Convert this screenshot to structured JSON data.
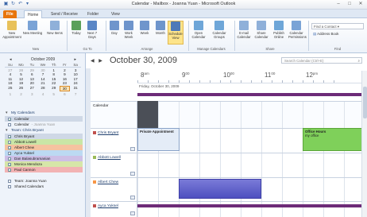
{
  "window": {
    "title": "Calendar - Mailbox - Joanna Yuan - Microsoft Outlook",
    "controls": [
      "–",
      "□",
      "✕"
    ]
  },
  "tabs": [
    "File",
    "Home",
    "Send / Receive",
    "Folder",
    "View"
  ],
  "ribbon": {
    "buttons": [
      {
        "label": "New Appointment",
        "icon": "new-appointment-icon",
        "color": "#e8c15a"
      },
      {
        "label": "New Meeting",
        "icon": "new-meeting-icon",
        "color": "#7aa3d6"
      },
      {
        "label": "New Items",
        "icon": "new-items-icon",
        "color": "#8fb0d9"
      },
      {
        "label": "Today",
        "icon": "today-icon",
        "color": "#5aa05a"
      },
      {
        "label": "Next 7 Days",
        "icon": "next-7-days-icon",
        "color": "#5a86c6"
      },
      {
        "label": "Day",
        "icon": "day-view-icon",
        "color": "#6f95cc"
      },
      {
        "label": "Work Week",
        "icon": "work-week-icon",
        "color": "#6f95cc"
      },
      {
        "label": "Week",
        "icon": "week-view-icon",
        "color": "#6f95cc"
      },
      {
        "label": "Month",
        "icon": "month-view-icon",
        "color": "#6f95cc"
      },
      {
        "label": "Schedule View",
        "icon": "schedule-view-icon",
        "color": "#4f79b8"
      },
      {
        "label": "Open Calendar",
        "icon": "open-calendar-icon",
        "color": "#6ea6d8"
      },
      {
        "label": "Calendar Groups",
        "icon": "calendar-groups-icon",
        "color": "#6ea6d8"
      },
      {
        "label": "E-mail Calendar",
        "icon": "email-calendar-icon",
        "color": "#8fb0d9"
      },
      {
        "label": "Share Calendar",
        "icon": "share-calendar-icon",
        "color": "#8fb0d9"
      },
      {
        "label": "Publish Online",
        "icon": "publish-online-icon",
        "color": "#6ea6d8"
      },
      {
        "label": "Calendar Permissions",
        "icon": "calendar-permissions-icon",
        "color": "#7aa3d6"
      }
    ],
    "groups": [
      "New",
      "Go To",
      "Arrange",
      "Manage Calendars",
      "Share",
      "Find"
    ],
    "find_placeholder": "Find a Contact ▾",
    "address_book": "Address Book"
  },
  "mini_calendar": {
    "month": "October 2009",
    "day_names": [
      "Su",
      "Mo",
      "Tu",
      "We",
      "Th",
      "Fr",
      "Sa"
    ],
    "weeks": [
      [
        "27",
        "28",
        "29",
        "30",
        "1",
        "2",
        "3"
      ],
      [
        "4",
        "5",
        "6",
        "7",
        "8",
        "9",
        "10"
      ],
      [
        "11",
        "12",
        "13",
        "14",
        "15",
        "16",
        "17"
      ],
      [
        "18",
        "19",
        "20",
        "21",
        "22",
        "23",
        "24"
      ],
      [
        "25",
        "26",
        "27",
        "28",
        "29",
        "30",
        "31"
      ],
      [
        "1",
        "2",
        "3",
        "4",
        "5",
        "6",
        "7"
      ]
    ]
  },
  "calendar_groups": [
    {
      "name": "My Calendars",
      "items": [
        {
          "label": "Calendar",
          "hint": "",
          "checked": true,
          "color": "#cfd8e6"
        },
        {
          "label": "Calendar",
          "hint": "- Joanna Yuan",
          "checked": false,
          "color": ""
        }
      ]
    },
    {
      "name": "Team: Chris Bryant",
      "items": [
        {
          "label": "Chris Bryant",
          "hint": "",
          "checked": true,
          "color": "#cfd8e6"
        },
        {
          "label": "Abbott Lowell",
          "hint": "",
          "checked": true,
          "color": "#c9e6a6"
        },
        {
          "label": "Albert Chew",
          "hint": "",
          "checked": true,
          "color": "#f5c3a0"
        },
        {
          "label": "Ayca Yuksel",
          "hint": "",
          "checked": true,
          "color": "#bcd9f2"
        },
        {
          "label": "Dan Balasubramanian",
          "hint": "",
          "checked": true,
          "color": "#cdbfe6"
        },
        {
          "label": "Monica Mendoza",
          "hint": "",
          "checked": true,
          "color": "#d6e6a8"
        },
        {
          "label": "Paul Cannon",
          "hint": "",
          "checked": true,
          "color": "#f2b3b3"
        }
      ]
    },
    {
      "name": "",
      "items": [
        {
          "label": "Team: Joanna Yuan",
          "hint": "",
          "checked": false,
          "color": ""
        },
        {
          "label": "Shared Calendars",
          "hint": "",
          "checked": false,
          "color": ""
        }
      ]
    }
  ],
  "main": {
    "date_heading": "October 30, 2009",
    "search_placeholder": "Search Calendar (Ctrl+E)",
    "day_label": "Friday, October 30, 2009",
    "hours": [
      {
        "h": "8",
        "ampm": "am"
      },
      {
        "h": "9",
        "ampm": "00"
      },
      {
        "h": "10",
        "ampm": "00"
      },
      {
        "h": "11",
        "ampm": "00"
      },
      {
        "h": "12",
        "ampm": "pm"
      }
    ]
  },
  "schedule": {
    "rows": [
      {
        "name": "Calendar",
        "color": ""
      },
      {
        "name": "Chris Bryant",
        "color": "#c0504d"
      },
      {
        "name": "Abbott Lowell",
        "color": "#9bbb59"
      },
      {
        "name": "Albert Chew",
        "color": "#f79646"
      },
      {
        "name": "Ayca Yuksel",
        "color": "#c0504d"
      }
    ],
    "appointments": [
      {
        "title": "Private Appointment",
        "subtitle": ""
      },
      {
        "title": "Office Hours",
        "subtitle": "my office"
      }
    ]
  }
}
